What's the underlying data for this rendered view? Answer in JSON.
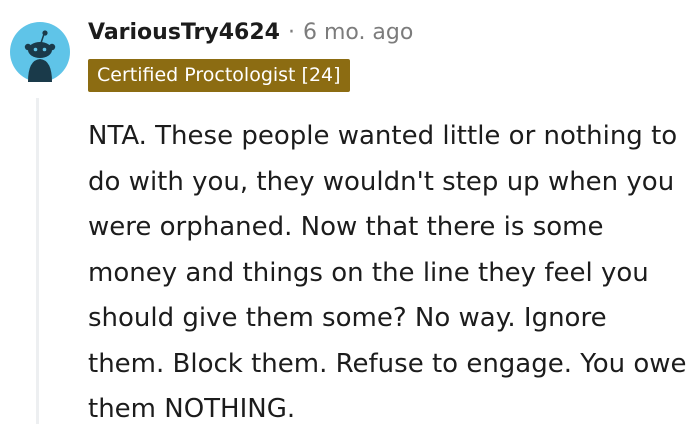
{
  "comment": {
    "username": "VariousTry4624",
    "separator": "·",
    "timestamp": "6 mo. ago",
    "flair": "Certified Proctologist [24]",
    "body": "NTA. These people wanted little or nothing to do with you, they wouldn't step up when you were orphaned. Now that there is some money and things on the line they feel you should give them some? No way. Ignore them. Block them. Refuse to engage. You owe them NOTHING.",
    "avatar_icon": "snoo-avatar-icon"
  },
  "colors": {
    "avatar_bg": "#5fc4e8",
    "flair_bg": "#8c6c12",
    "flair_text": "#ffffff",
    "meta_text": "#7c7c7c",
    "body_text": "#1c1c1c",
    "thread_line": "#edeff1"
  }
}
